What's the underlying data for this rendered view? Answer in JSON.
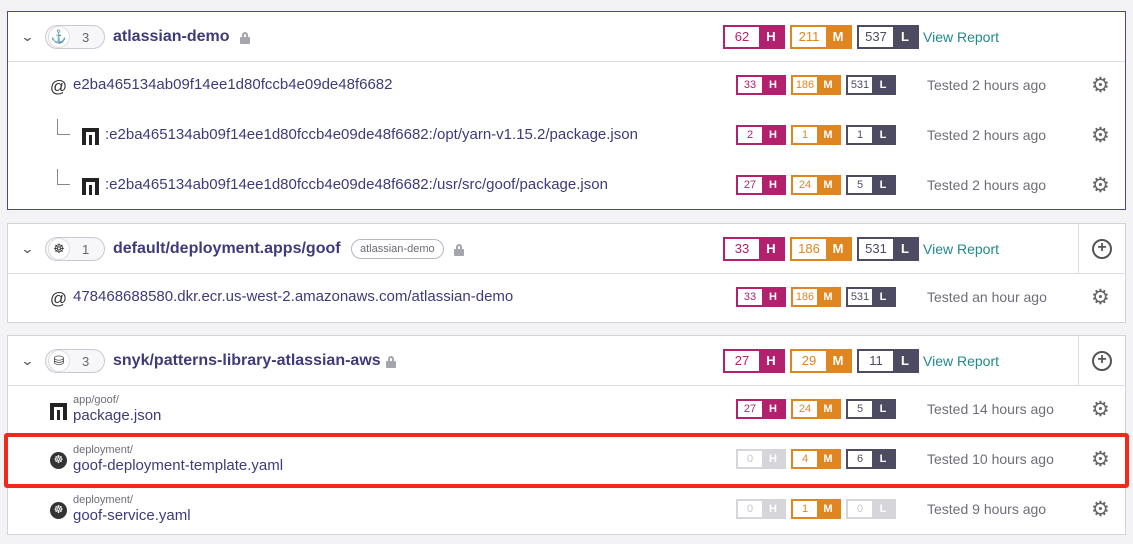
{
  "groups": [
    {
      "count": "3",
      "icon": "docker-icon",
      "title": "atlassian-demo",
      "private": true,
      "severity": {
        "h": "62",
        "m": "211",
        "l": "537"
      },
      "report_label": "View Report",
      "rows": [
        {
          "name": "e2ba465134ab09f14ee1d80fccb4e09de48f6682",
          "icon": "debian-icon",
          "severity": {
            "h": "33",
            "m": "186",
            "l": "531"
          },
          "tested": "Tested 2 hours ago"
        },
        {
          "name": ":e2ba465134ab09f14ee1d80fccb4e09de48f6682:/opt/yarn-v1.15.2/package.json",
          "icon": "npm-icon",
          "severity": {
            "h": "2",
            "m": "1",
            "l": "1"
          },
          "tested": "Tested 2 hours ago"
        },
        {
          "name": ":e2ba465134ab09f14ee1d80fccb4e09de48f6682:/usr/src/goof/package.json",
          "icon": "npm-icon",
          "severity": {
            "h": "27",
            "m": "24",
            "l": "5"
          },
          "tested": "Tested 2 hours ago"
        }
      ]
    },
    {
      "count": "1",
      "icon": "kubernetes-icon",
      "title": "default/deployment.apps/goof",
      "tag": "atlassian-demo",
      "private": true,
      "severity": {
        "h": "33",
        "m": "186",
        "l": "531"
      },
      "report_label": "View Report",
      "rows": [
        {
          "name": "478468688580.dkr.ecr.us-west-2.amazonaws.com/atlassian-demo",
          "icon": "debian-icon",
          "severity": {
            "h": "33",
            "m": "186",
            "l": "531"
          },
          "tested": "Tested an hour ago"
        }
      ]
    },
    {
      "count": "3",
      "icon": "bitbucket-icon",
      "title": "snyk/patterns-library-atlassian-aws",
      "private": true,
      "severity": {
        "h": "27",
        "m": "29",
        "l": "11"
      },
      "report_label": "View Report",
      "rows": [
        {
          "path": "app/goof/",
          "name": "package.json",
          "icon": "npm-icon",
          "severity": {
            "h": "27",
            "m": "24",
            "l": "5"
          },
          "tested": "Tested 14 hours ago"
        },
        {
          "path": "deployment/",
          "name": "goof-deployment-template.yaml",
          "icon": "kubernetes-icon",
          "severity": {
            "h": "0",
            "m": "4",
            "l": "6"
          },
          "tested": "Tested 10 hours ago"
        },
        {
          "path": "deployment/",
          "name": "goof-service.yaml",
          "icon": "kubernetes-icon",
          "severity": {
            "h": "0",
            "m": "1",
            "l": "0"
          },
          "tested": "Tested 9 hours ago"
        }
      ]
    }
  ],
  "labels": {
    "h": "H",
    "m": "M",
    "l": "L"
  },
  "colors": {
    "high": "#b3206d",
    "medium": "#df8621",
    "low": "#4d4b62",
    "zero": "#d5d5da",
    "highlight": "#f0291a"
  }
}
